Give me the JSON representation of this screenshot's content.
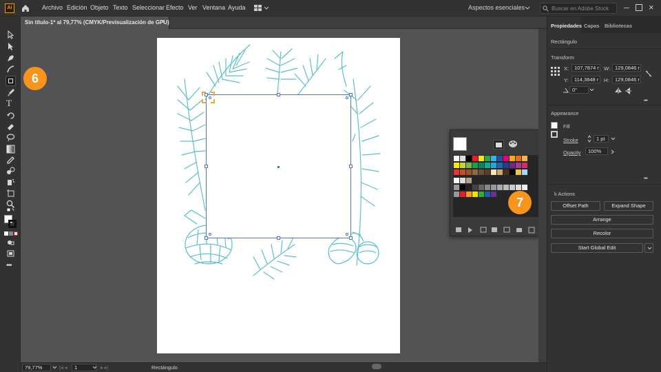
{
  "app": {
    "logo": "Ai"
  },
  "menu": [
    "Archivo",
    "Edición",
    "Objeto",
    "Texto",
    "Seleccionar",
    "Efecto",
    "Ver",
    "Ventana",
    "Ayuda"
  ],
  "workspace": "Aspectos esenciales",
  "search": {
    "placeholder": "Buscar en Adobe Stock"
  },
  "document_tab": {
    "title": "Sin título-1* al 79,77% (CMYK/Previsualización de GPU)",
    "close": "×"
  },
  "badges": {
    "left": "6",
    "swatches": "7"
  },
  "properties": {
    "tabs": [
      "Propiedades",
      "Capas",
      "Bibliotecas"
    ],
    "object_type": "Rectángulo",
    "transform": {
      "title": "Transform",
      "x_label": "X:",
      "x": "107,7874 r",
      "y_label": "Y:",
      "y": "114,3848 r",
      "w_label": "W:",
      "w": "129,0846 r",
      "h_label": "H:",
      "h": "129,0846 r",
      "angle": "0°"
    },
    "appearance": {
      "title": "Appearance",
      "fill": "Fill",
      "stroke": "Stroke",
      "stroke_value": "1 pt",
      "opacity": "Opacity",
      "opacity_value": "100%"
    },
    "quick_actions": {
      "title": "k Actions",
      "offset_path": "Offset Path",
      "expand_shape": "Expand Shape",
      "arrange": "Arrange",
      "recolor": "Recolor",
      "global_edit": "Start Global Edit"
    },
    "more": "•••"
  },
  "status": {
    "zoom": "79,77%",
    "page": "1",
    "tool": "Rectángulo"
  },
  "colors": {
    "accent": "#f7941d",
    "selection": "#4a6fe8",
    "illustration": "#5bbfcb"
  }
}
